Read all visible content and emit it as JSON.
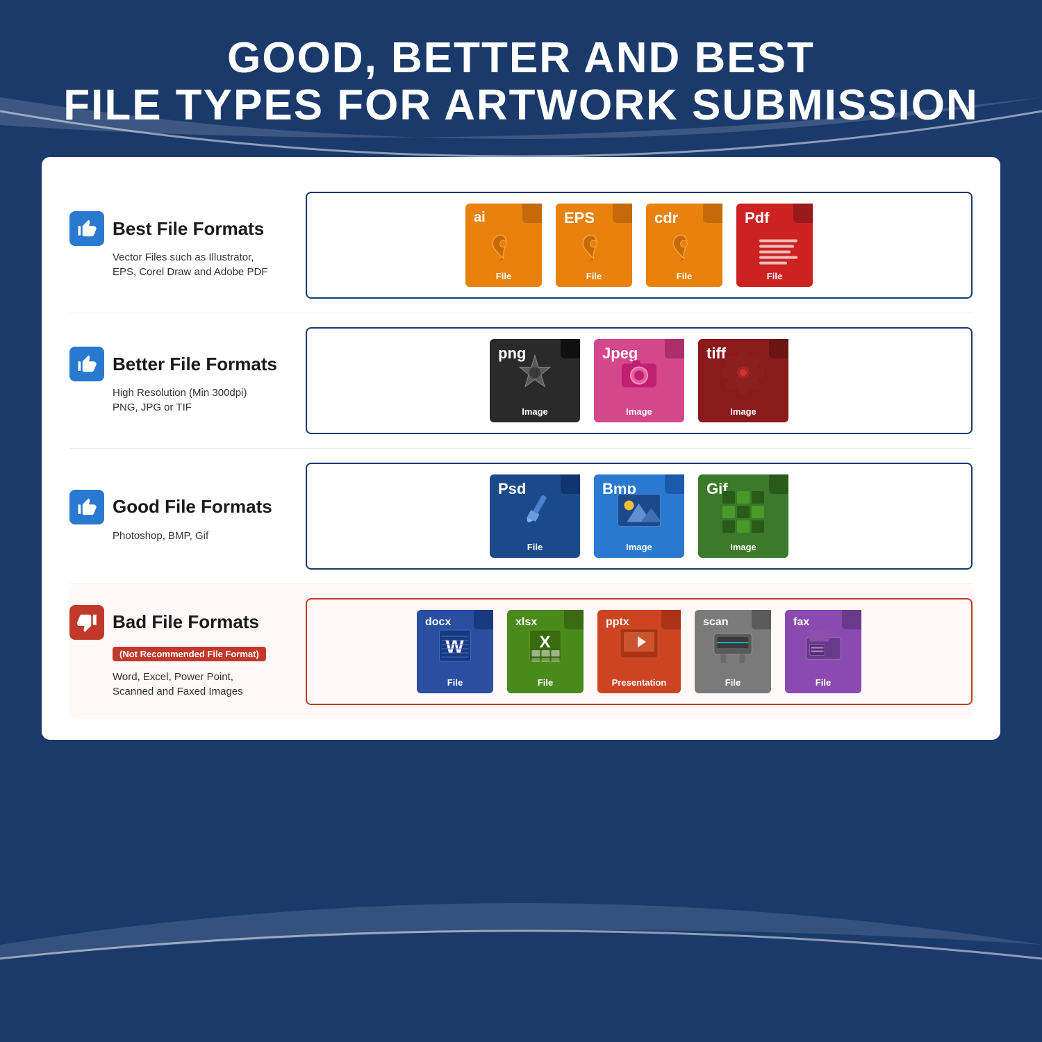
{
  "page": {
    "title_line1": "GOOD, BETTER AND BEST",
    "title_line2": "FILE TYPES FOR ARTWORK SUBMISSION",
    "bg_color": "#1a3a6b"
  },
  "rows": [
    {
      "id": "best",
      "title": "Best File Formats",
      "subtitle": "Vector Files such as Illustrator,\nEPS, Corel Draw and Adobe PDF",
      "badge": null,
      "thumbs": "up",
      "files": [
        {
          "ext": "ai",
          "type": "ai",
          "label": "File",
          "icon": "pen"
        },
        {
          "ext": "EPS",
          "type": "eps",
          "label": "File",
          "icon": "pen"
        },
        {
          "ext": "cdr",
          "type": "cdr",
          "label": "File",
          "icon": "pen"
        },
        {
          "ext": "Pdf",
          "type": "pdf",
          "label": "File",
          "icon": "doc"
        }
      ],
      "border": "normal"
    },
    {
      "id": "better",
      "title": "Better File Formats",
      "subtitle": "High Resolution (Min 300dpi)\nPNG, JPG or TIF",
      "badge": null,
      "thumbs": "up",
      "files": [
        {
          "ext": "png",
          "type": "png",
          "label": "Image",
          "icon": "star"
        },
        {
          "ext": "Jpeg",
          "type": "jpeg",
          "label": "Image",
          "icon": "camera"
        },
        {
          "ext": "tiff",
          "type": "tiff",
          "label": "Image",
          "icon": "flower"
        }
      ],
      "border": "normal"
    },
    {
      "id": "good",
      "title": "Good File Formats",
      "subtitle": "Photoshop, BMP, Gif",
      "badge": null,
      "thumbs": "up",
      "files": [
        {
          "ext": "Psd",
          "type": "psd",
          "label": "File",
          "icon": "brush"
        },
        {
          "ext": "Bmp",
          "type": "bmp",
          "label": "Image",
          "icon": "mountain"
        },
        {
          "ext": "Gif",
          "type": "gif",
          "label": "Image",
          "icon": "grid"
        }
      ],
      "border": "normal"
    },
    {
      "id": "bad",
      "title": "Bad File Formats",
      "badge": "(Not Recommended File Format)",
      "subtitle": "Word, Excel, Power Point,\nScanned and Faxed Images",
      "thumbs": "down",
      "files": [
        {
          "ext": "docx",
          "type": "docx",
          "label": "File",
          "icon": "word"
        },
        {
          "ext": "xlsx",
          "type": "xlsx",
          "label": "File",
          "icon": "excel"
        },
        {
          "ext": "pptx",
          "type": "pptx",
          "label": "Presentation",
          "icon": "ppt"
        },
        {
          "ext": "scan",
          "type": "scan",
          "label": "File",
          "icon": "scanner"
        },
        {
          "ext": "fax",
          "type": "fax",
          "label": "File",
          "icon": "fax"
        }
      ],
      "border": "bad"
    }
  ]
}
